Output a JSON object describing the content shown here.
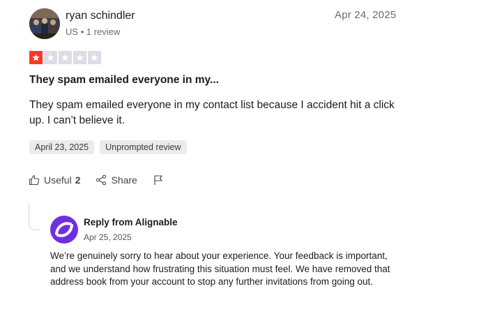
{
  "reviewer": {
    "name": "ryan schindler",
    "country": "US",
    "separator": "•",
    "review_count": "1 review"
  },
  "review": {
    "date": "Apr 24, 2025",
    "rating": 1,
    "max_rating": 5,
    "title": "They spam emailed everyone in my...",
    "body": "They spam emailed everyone in my contact list because I accident hit a click up. I can’t believe it.",
    "tags": [
      "April 23, 2025",
      "Unprompted review"
    ]
  },
  "actions": {
    "useful_label": "Useful",
    "useful_count": "2",
    "share_label": "Share"
  },
  "reply": {
    "title": "Reply from Alignable",
    "date": "Apr 25, 2025",
    "body": "We’re genuinely sorry to hear about your experience. Your feedback is important, and we understand how frustrating this situation must feel. We have removed that address book from your account to stop any further invitations from going out."
  },
  "colors": {
    "star_active": "#ff3722",
    "star_inactive": "#dcdce6",
    "brand_logo": "#6f2fe0",
    "tag_bg": "#ebebeb"
  },
  "icons": {
    "useful": "thumbs-up-icon",
    "share": "share-icon",
    "flag": "flag-icon",
    "star": "star-icon"
  }
}
